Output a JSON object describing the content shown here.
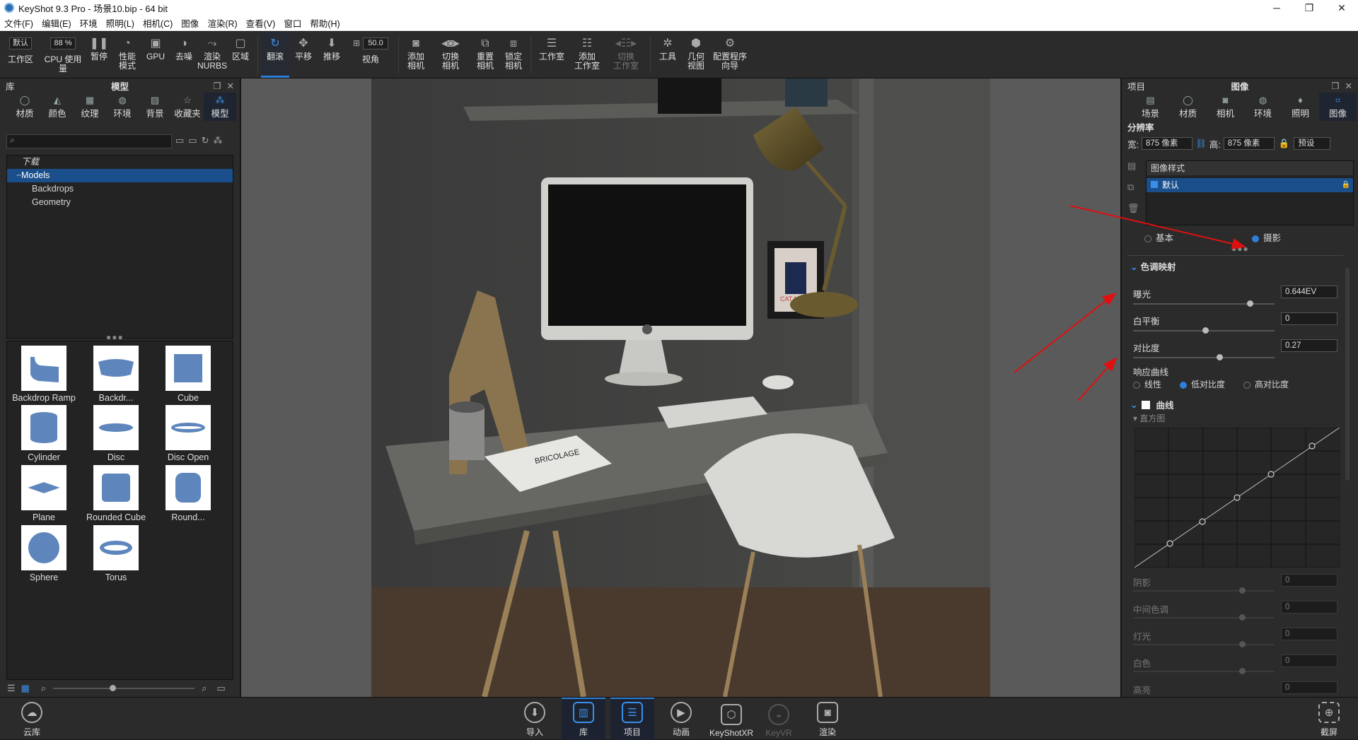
{
  "titlebar": {
    "title": "KeyShot 9.3 Pro  - 场景10.bip  - 64 bit",
    "minimize": "─",
    "maximize": "❐",
    "close": "✕"
  },
  "menu": [
    "文件(F)",
    "编辑(E)",
    "环境",
    "照明(L)",
    "相机(C)",
    "图像",
    "渲染(R)",
    "查看(V)",
    "窗口",
    "帮助(H)"
  ],
  "toolbar": {
    "workspace_select": "默认",
    "cpu_select": "88 %",
    "fov_value": "50.0",
    "items": {
      "workspace": "工作区",
      "cpu": "CPU 使用量",
      "pause": "暂停",
      "perf": "性能\n模式",
      "gpu": "GPU",
      "denoise": "去噪",
      "nurbs": "渲染\nNURBS",
      "region": "区域",
      "tumble": "翻滚",
      "pan": "平移",
      "dolly": "推移",
      "fov": "视角",
      "add_cam": "添加\n相机",
      "switch_cam": "切换\n相机",
      "reset_cam": "重置\n相机",
      "lock_cam": "锁定\n相机",
      "studio": "工作室",
      "add_studio": "添加\n工作室",
      "switch_studio": "切换\n工作室",
      "tools": "工具",
      "geo_view": "几何\n视图",
      "wizard": "配置程序\n向导"
    }
  },
  "library": {
    "header_left": "库",
    "header_title": "模型",
    "tabs": [
      "材质",
      "颜色",
      "纹理",
      "环境",
      "背景",
      "收藏夹",
      "模型"
    ],
    "tree": {
      "downloads": "下载",
      "models": "Models",
      "children": [
        "Backdrops",
        "Geometry"
      ]
    },
    "models": [
      "Backdrop Ramp",
      "Backdr...",
      "Cube",
      "Cylinder",
      "Disc",
      "Disc Open",
      "Plane",
      "Rounded Cube",
      "Round...",
      "Sphere",
      "Torus"
    ]
  },
  "project": {
    "header_left": "项目",
    "header_title": "图像",
    "tabs": [
      "场景",
      "材质",
      "相机",
      "环境",
      "照明",
      "图像"
    ],
    "resolution_label": "分辨率",
    "width_label": "宽:",
    "width_value": "875 像素",
    "height_label": "高:",
    "height_value": "875 像素",
    "preset": "预设",
    "image_style_label": "图像样式",
    "image_style_selected": "默认",
    "mode_basic": "基本",
    "mode_photo": "摄影",
    "tonemap_label": "色调映射",
    "exposure_label": "曝光",
    "exposure_value": "0.644EV",
    "exposure_level": 0.82,
    "wb_label": "白平衡",
    "wb_value": "0",
    "wb_level": 0.5,
    "contrast_label": "对比度",
    "contrast_value": "0.27",
    "contrast_level": 0.6,
    "response_label": "响应曲线",
    "curve_linear": "线性",
    "curve_low": "低对比度",
    "curve_high": "高对比度",
    "curves_label": "曲线",
    "histogram_label": "直方图",
    "shadows_label": "阴影",
    "shadows_value": "0",
    "midtones_label": "中间色调",
    "midtones_value": "0",
    "lights_label": "灯光",
    "lights_value": "0",
    "whites_label": "白色",
    "whites_value": "0",
    "highlights_label": "高亮",
    "highlights_value": "0"
  },
  "scene": {
    "book_text": "BRICOLAGE",
    "poster_text": "CAT MAN"
  },
  "bottombar": {
    "cloud": "云库",
    "import": "导入",
    "library": "库",
    "project": "项目",
    "animation": "动画",
    "keyshotxr": "KeyShotXR",
    "keyvr": "KeyVR",
    "render": "渲染",
    "screenshot": "截屏"
  },
  "colors": {
    "accent": "#2d7fd8",
    "selected_row": "#1a4f8c",
    "annotation_arrow": "#e01010"
  }
}
